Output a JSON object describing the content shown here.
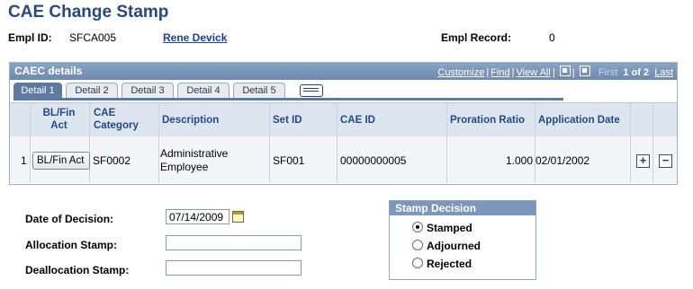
{
  "page": {
    "title": "CAE Change Stamp"
  },
  "employee": {
    "empl_id_label": "Empl ID:",
    "empl_id": "SFCA005",
    "name": "Rene Devick",
    "record_label": "Empl Record:",
    "record": "0"
  },
  "grid": {
    "title": "CAEC details",
    "nav": {
      "customize": "Customize",
      "find": "Find",
      "view_all": "View All",
      "first": "First",
      "count": "1 of 2",
      "last": "Last"
    },
    "tabs": [
      "Detail 1",
      "Detail 2",
      "Detail 3",
      "Detail 4",
      "Detail 5"
    ],
    "columns": [
      "BL/Fin Act",
      "CAE Category",
      "Description",
      "Set ID",
      "CAE ID",
      "Proration Ratio",
      "Application Date"
    ],
    "row": {
      "num": "1",
      "btn": "BL/Fin Act",
      "category": "SF0002",
      "description": "Administrative Employee",
      "setid": "SF001",
      "caeid": "00000000005",
      "ratio": "1.000",
      "date": "02/01/2002"
    },
    "add": "+",
    "remove": "−"
  },
  "form": {
    "decision_label": "Date of Decision:",
    "decision_value": "07/14/2009",
    "alloc_label": "Allocation Stamp:",
    "alloc_value": "",
    "dealloc_label": "Deallocation Stamp:",
    "dealloc_value": ""
  },
  "stamp": {
    "title": "Stamp Decision",
    "options": [
      "Stamped",
      "Adjourned",
      "Rejected"
    ],
    "selected": "Stamped"
  },
  "icons": {
    "tabs_expand": "grid-view-icon",
    "calendar": "calendar-icon",
    "download": "download-icon",
    "grid": "grid-icon"
  },
  "colors": {
    "title": "#274a7d",
    "header_bar": "#7d97bb",
    "link": "#1b3fa0"
  }
}
